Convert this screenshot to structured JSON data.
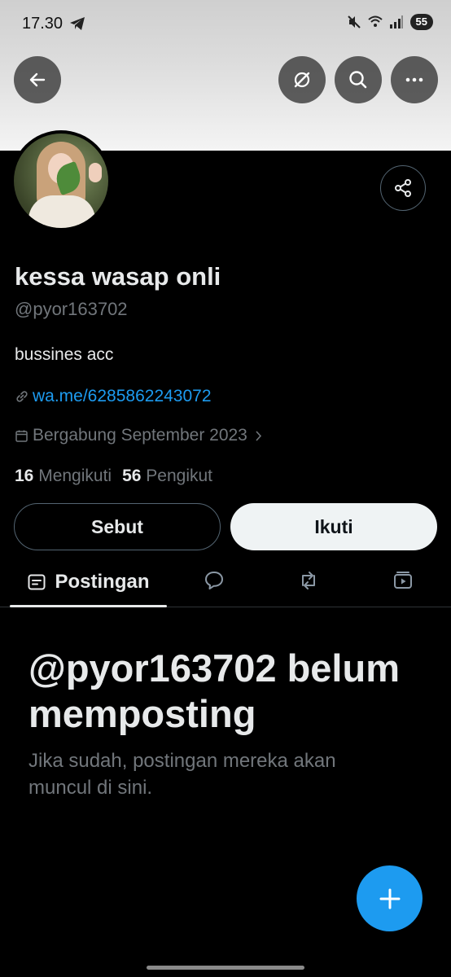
{
  "status_bar": {
    "time": "17.30",
    "battery": "55",
    "icons": [
      "telegram-icon",
      "mute-icon",
      "wifi-icon",
      "signal-icon"
    ]
  },
  "header": {
    "buttons": [
      "back-arrow-icon",
      "grok-icon",
      "search-icon",
      "more-icon"
    ]
  },
  "profile": {
    "display_name": "kessa wasap onli",
    "handle": "@pyor163702",
    "bio": "bussines acc",
    "link": "wa.me/6285862243072",
    "joined": "Bergabung September 2023",
    "following_count": "16",
    "following_label": "Mengikuti",
    "followers_count": "56",
    "followers_label": "Pengikut"
  },
  "actions": {
    "mention_label": "Sebut",
    "follow_label": "Ikuti"
  },
  "tabs": {
    "posts_label": "Postingan",
    "icons": [
      "posts-icon",
      "replies-icon",
      "reposts-icon",
      "media-icon"
    ]
  },
  "empty_state": {
    "title": "@pyor163702 belum memposting",
    "subtitle": "Jika sudah, postingan mereka akan muncul di sini."
  },
  "colors": {
    "accent": "#1d9bf0",
    "background": "#000000",
    "secondary_text": "#71767b"
  }
}
